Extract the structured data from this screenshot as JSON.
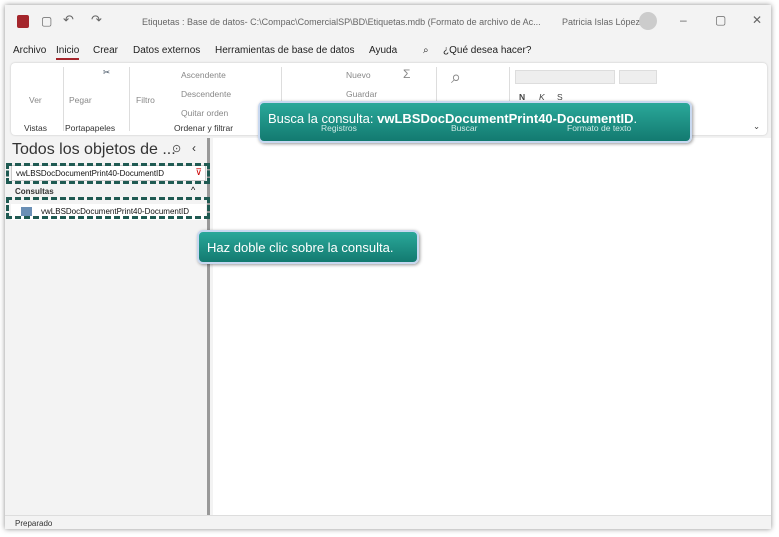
{
  "title_bar": {
    "title": "Etiquetas : Base de datos- C:\\Compac\\ComercialSP\\BD\\Etiquetas.mdb (Formato de archivo de Ac...",
    "user": "Patricia Islas López"
  },
  "menu": {
    "tabs": [
      "Archivo",
      "Inicio",
      "Crear",
      "Datos externos",
      "Herramientas de base de datos",
      "Ayuda"
    ],
    "search": "¿Qué desea hacer?"
  },
  "ribbon": {
    "ver": "Ver",
    "pegar": "Pegar",
    "filtro": "Filtro",
    "ascendente": "Ascendente",
    "descendente": "Descendente",
    "quitar_orden": "Quitar orden",
    "nuevo": "Nuevo",
    "guardar": "Guardar",
    "groups": {
      "vistas": "Vistas",
      "portapapeles": "Portapapeles",
      "ordenar": "Ordenar y filtrar",
      "registros": "Registros",
      "buscar": "Buscar",
      "formato": "Formato de texto"
    },
    "bold": "N",
    "italic": "K",
    "underline": "S"
  },
  "nav": {
    "title": "Todos los objetos de ...",
    "search_value": "vwLBSDocDocumentPrint40-DocumentID",
    "section": "Consultas",
    "item": "vwLBSDocDocumentPrint40-DocumentID"
  },
  "callouts": {
    "search": "Busca la consulta: ",
    "search_bold": "vwLBSDocDocumentPrint40-DocumentID",
    "search_end": ".",
    "dblclick": "Haz doble clic sobre la consulta."
  },
  "status": "Preparado"
}
